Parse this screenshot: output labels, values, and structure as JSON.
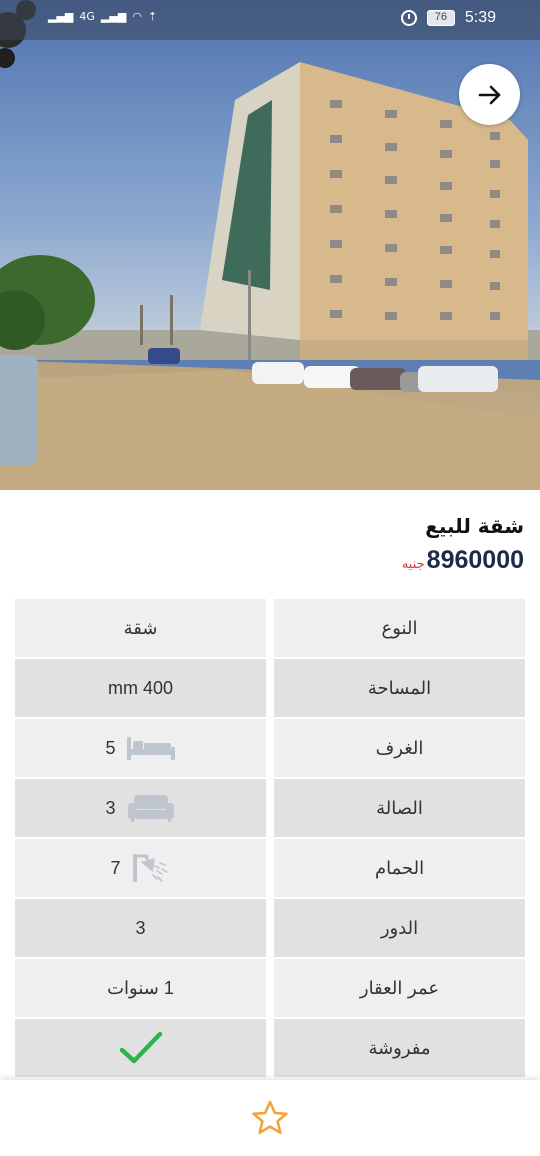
{
  "status_bar": {
    "network": "4G",
    "battery": "76",
    "time": "5:39"
  },
  "listing": {
    "title": "شقة للبيع",
    "price": "8960000",
    "currency": "جنيه"
  },
  "details": [
    {
      "label": "النوع",
      "value": "شقة",
      "icon": ""
    },
    {
      "label": "المساحة",
      "value": "mm 400",
      "icon": ""
    },
    {
      "label": "الغرف",
      "value": "5",
      "icon": "bed-icon"
    },
    {
      "label": "الصالة",
      "value": "3",
      "icon": "sofa-icon"
    },
    {
      "label": "الحمام",
      "value": "7",
      "icon": "shower-icon"
    },
    {
      "label": "الدور",
      "value": "3",
      "icon": ""
    },
    {
      "label": "عمر العقار",
      "value": "1 سنوات",
      "icon": ""
    },
    {
      "label": "مفروشة",
      "value": "",
      "icon": "checkmark-icon"
    }
  ],
  "colors": {
    "price": "#1e2a4a",
    "currency": "#d93a3a",
    "checkmark": "#2db34a",
    "star": "#f0a43a",
    "row_light": "#efefef",
    "row_dark": "#e1e1e1"
  },
  "icons": {
    "next": "arrow-right-icon",
    "favorite": "star-outline-icon"
  }
}
